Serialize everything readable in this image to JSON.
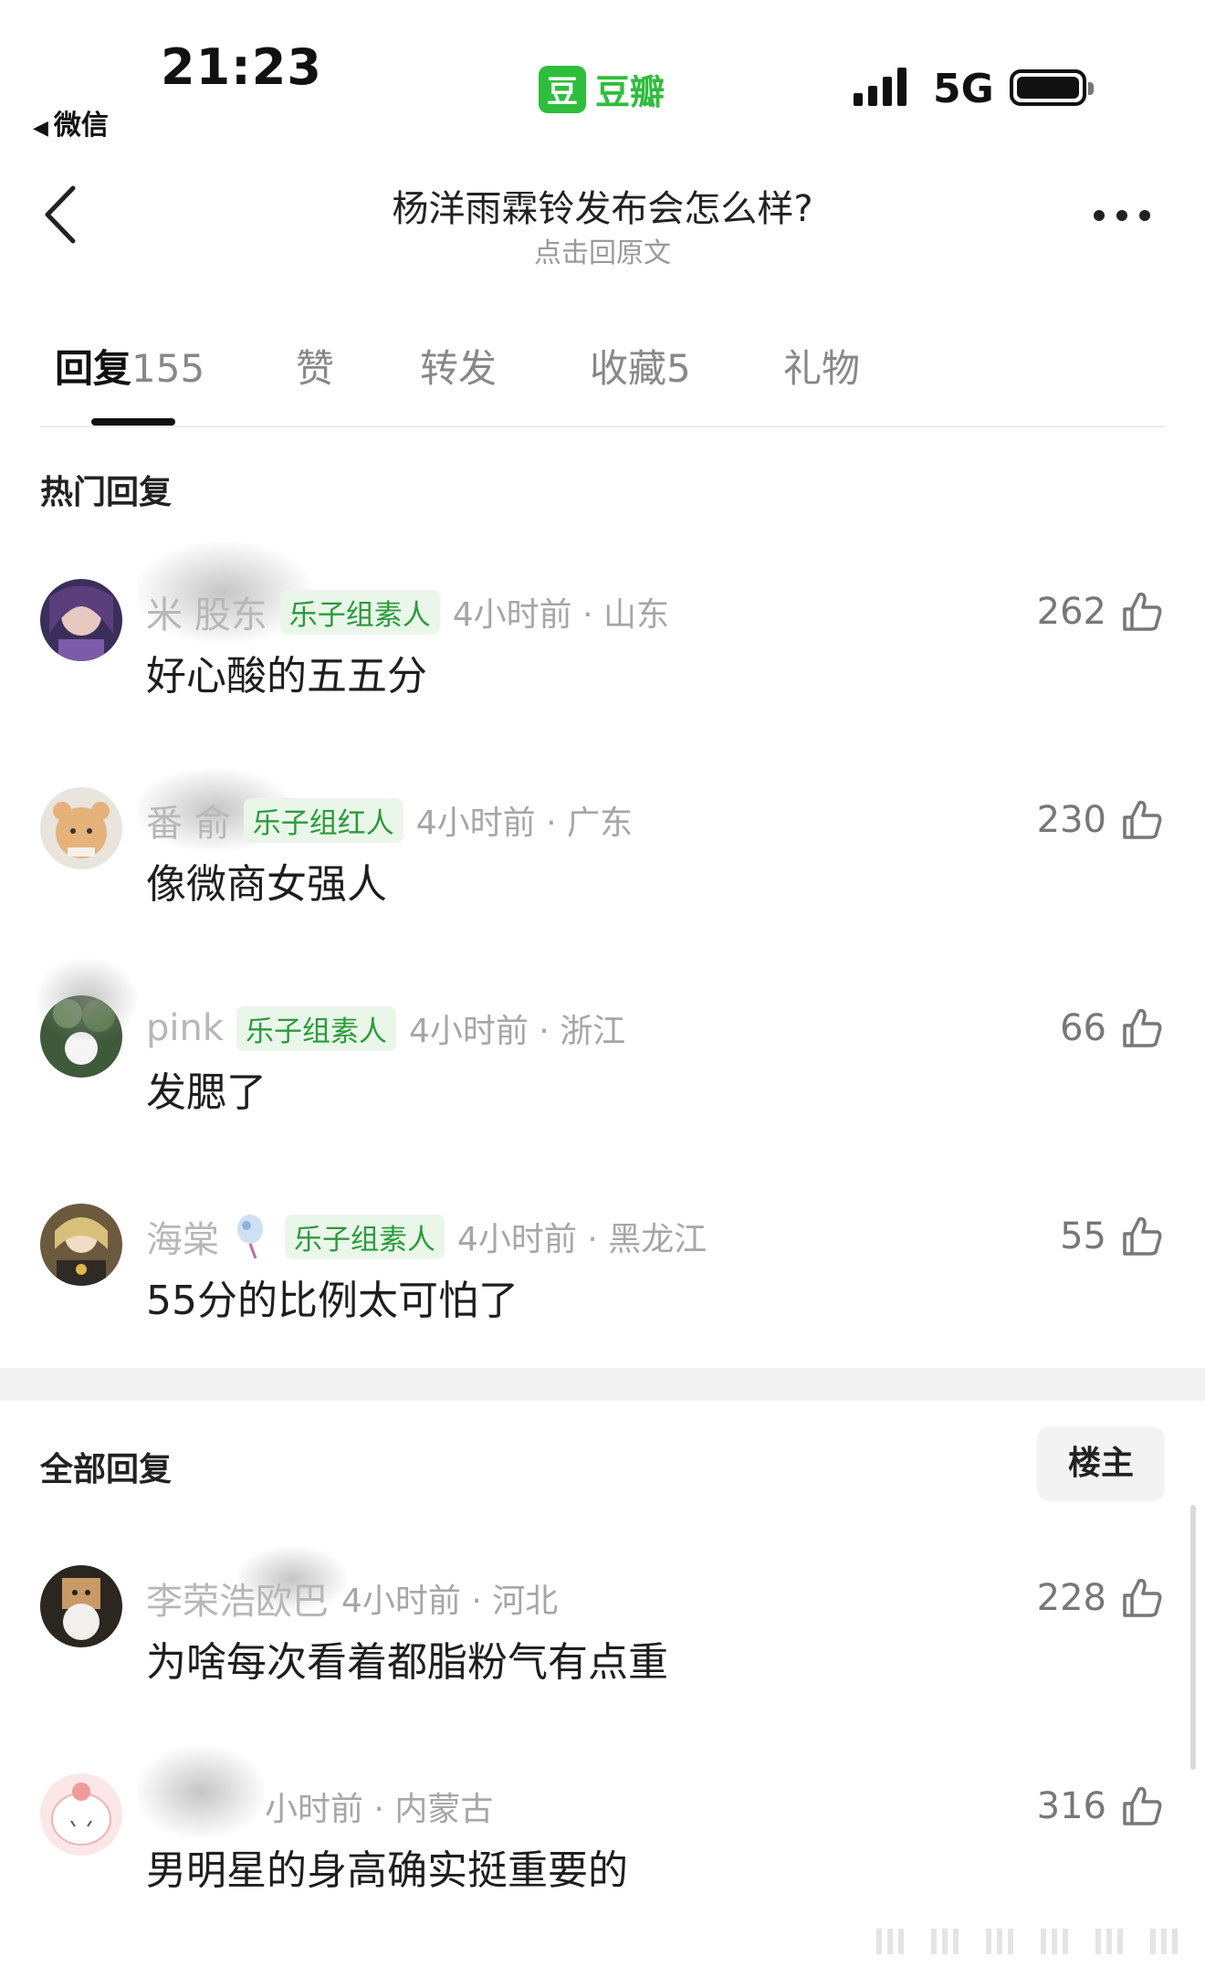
{
  "status_bar": {
    "time": "21:23",
    "back_app": "微信",
    "app_logo_char": "豆",
    "app_name": "豆瓣",
    "network": "5G",
    "brand_color": "#2dbe3c"
  },
  "nav": {
    "title": "杨洋雨霖铃发布会怎么样?",
    "subtitle": "点击回原文",
    "back_icon": "chevron-left-icon",
    "more_icon": "more-dots-icon"
  },
  "tabs": [
    {
      "label": "回复",
      "count": "155",
      "active": true
    },
    {
      "label": "赞",
      "count": ""
    },
    {
      "label": "转发",
      "count": ""
    },
    {
      "label": "收藏",
      "count": "5"
    },
    {
      "label": "礼物",
      "count": ""
    }
  ],
  "hot_section": {
    "title": "热门回复",
    "comments": [
      {
        "name": "米        股东",
        "badge": "乐子组素人",
        "meta": "4小时前 · 山东",
        "text": "好心酸的五五分",
        "likes": "262"
      },
      {
        "name": "番          俞",
        "badge": "乐子组红人",
        "meta": "4小时前 · 广东",
        "text": "像微商女强人",
        "likes": "230"
      },
      {
        "name": "pink",
        "badge": "乐子组素人",
        "meta": "4小时前 · 浙江",
        "text": "发腮了",
        "likes": "66"
      },
      {
        "name": "海棠",
        "badge": "乐子组素人",
        "meta": "4小时前 · 黑龙江",
        "text": "55分的比例太可怕了",
        "likes": "55"
      }
    ]
  },
  "all_section": {
    "title": "全部回复",
    "owner_button": "楼主",
    "comments": [
      {
        "name": "李荣浩欧巴",
        "meta": "4小时前 · 河北",
        "text": "为啥每次看着都脂粉气有点重",
        "likes": "228"
      },
      {
        "name": "",
        "meta": "小时前 · 内蒙古",
        "text": "男明星的身高确实挺重要的",
        "likes": "316"
      }
    ]
  },
  "colors": {
    "badge_text": "#2a9b3a",
    "badge_bg": "#eaf6ea",
    "meta_gray": "#a6a6a6"
  }
}
